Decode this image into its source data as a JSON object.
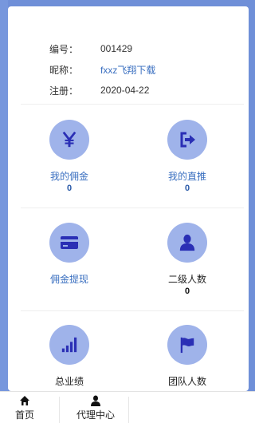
{
  "profile": {
    "id_label": "编号：",
    "id_value": "001429",
    "nick_label": "昵称：",
    "nick_value": "fxxz飞翔下载",
    "reg_label": "注册：",
    "reg_value": "2020-04-22"
  },
  "tiles": [
    {
      "label": "我的佣金",
      "value": "0",
      "icon": "yen-icon"
    },
    {
      "label": "我的直推",
      "value": "0",
      "icon": "sign-out-icon"
    },
    {
      "label": "佣金提现",
      "icon": "credit-card-icon"
    },
    {
      "label": "二级人数",
      "value": "0",
      "icon": "user-icon"
    },
    {
      "label": "总业绩",
      "icon": "bar-chart-icon"
    },
    {
      "label": "团队人数",
      "icon": "flag-icon"
    }
  ],
  "nav": {
    "home": "首页",
    "agent": "代理中心"
  },
  "colors": {
    "accent": "#3a6fc0",
    "icon_bg": "#9fb3ea",
    "icon_fg": "#2a2fb5",
    "background": "#6f8fd8"
  }
}
